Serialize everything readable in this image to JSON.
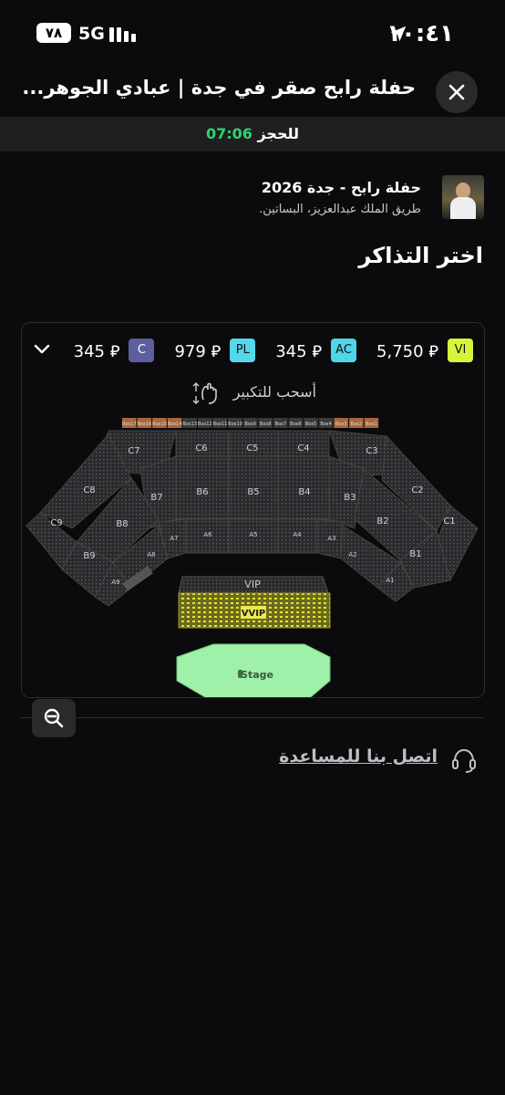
{
  "status_bar": {
    "time": "١٠:٤١",
    "network": "5G",
    "battery": "٧٨"
  },
  "header": {
    "title": "حفلة رابح صقر في جدة | عبادي الجوهر..."
  },
  "timer": {
    "time": "07:06",
    "label": "للحجز"
  },
  "event": {
    "name": "حفلة رابح - جدة 2026",
    "location": "طريق الملك عبدالعزيز، البساتين."
  },
  "section_title": "اختر التذاكر",
  "legend": [
    {
      "code": "VI",
      "price": "5,750",
      "color": "#d6f53a"
    },
    {
      "code": "AC",
      "price": "345",
      "color": "#4fd6e8"
    },
    {
      "code": "PL",
      "price": "979",
      "color": "#53d8ec"
    },
    {
      "code": "C",
      "price": "345",
      "color": "#5c5e9e"
    }
  ],
  "currency": "⃁",
  "drag_hint": "أسحب للتكبير",
  "seat_map": {
    "boxes": [
      "Box17",
      "Box16",
      "Box15",
      "Box14",
      "Box13",
      "Box12",
      "Box11",
      "Box10",
      "Box9",
      "Box8",
      "Box7",
      "Box6",
      "Box5",
      "Box4",
      "Box3",
      "Box2",
      "Box1"
    ],
    "sections_c": [
      "C7",
      "C6",
      "C5",
      "C4",
      "C3",
      "C8",
      "C2",
      "C9",
      "C1"
    ],
    "sections_b": [
      "B7",
      "B6",
      "B5",
      "B4",
      "B3",
      "B8",
      "B2",
      "B9",
      "B1"
    ],
    "sections_a": [
      "A7",
      "A6",
      "A5",
      "A4",
      "A3",
      "A8",
      "A2",
      "A9",
      "A1"
    ],
    "vip_label": "VIP",
    "vvip_label": "VVIP",
    "stage_label": "Stage"
  },
  "help": {
    "label": "اتصل بنا للمساعدة"
  }
}
